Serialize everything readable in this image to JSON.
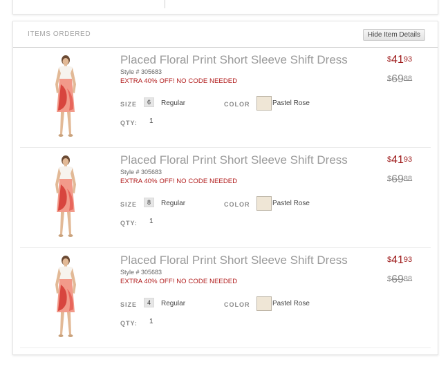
{
  "section": {
    "title": "ITEMS ORDERED",
    "hide_button_label": "Hide Item Details"
  },
  "labels": {
    "size": "SIZE",
    "color": "COLOR",
    "qty": "QTY:"
  },
  "colors": {
    "price_red": "#9e1b1b",
    "promo_red": "#b11a1a",
    "swatch_pastel_rose": "#efe6d6"
  },
  "items": [
    {
      "name": "Placed Floral Print Short Sleeve Shift Dress",
      "style": "Style # 305683",
      "promo": "EXTRA 40% OFF! NO CODE NEEDED",
      "size": "6",
      "size_type": "Regular",
      "color": "Pastel Rose",
      "qty": "1",
      "price": {
        "symbol": "$",
        "dollars": "41",
        "cents": "93"
      },
      "original_price": {
        "symbol": "$",
        "dollars": "69",
        "cents": "88"
      }
    },
    {
      "name": "Placed Floral Print Short Sleeve Shift Dress",
      "style": "Style # 305683",
      "promo": "EXTRA 40% OFF! NO CODE NEEDED",
      "size": "8",
      "size_type": "Regular",
      "color": "Pastel Rose",
      "qty": "1",
      "price": {
        "symbol": "$",
        "dollars": "41",
        "cents": "93"
      },
      "original_price": {
        "symbol": "$",
        "dollars": "69",
        "cents": "88"
      }
    },
    {
      "name": "Placed Floral Print Short Sleeve Shift Dress",
      "style": "Style # 305683",
      "promo": "EXTRA 40% OFF! NO CODE NEEDED",
      "size": "4",
      "size_type": "Regular",
      "color": "Pastel Rose",
      "qty": "1",
      "price": {
        "symbol": "$",
        "dollars": "41",
        "cents": "93"
      },
      "original_price": {
        "symbol": "$",
        "dollars": "69",
        "cents": "88"
      }
    }
  ]
}
